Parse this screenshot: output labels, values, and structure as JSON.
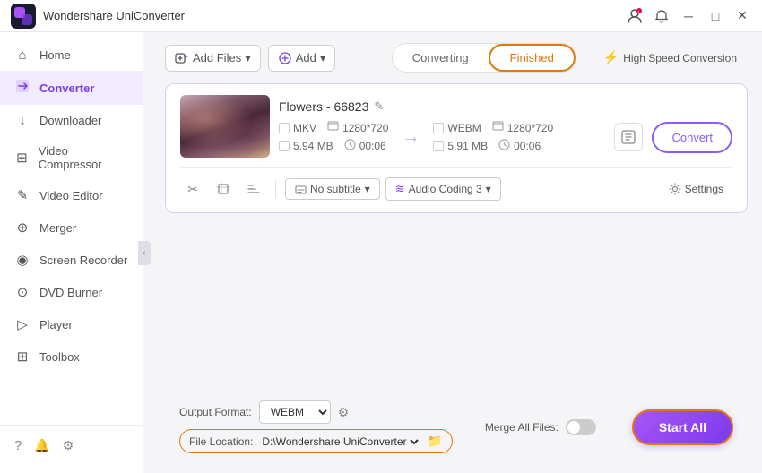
{
  "app": {
    "title": "Wondershare UniConverter",
    "logo_text": "W"
  },
  "titlebar": {
    "controls": [
      "user-icon",
      "bell-icon",
      "minimize",
      "maximize",
      "close"
    ]
  },
  "sidebar": {
    "items": [
      {
        "id": "home",
        "label": "Home",
        "icon": "⌂",
        "active": false
      },
      {
        "id": "converter",
        "label": "Converter",
        "icon": "⇄",
        "active": true
      },
      {
        "id": "downloader",
        "label": "Downloader",
        "icon": "↓",
        "active": false
      },
      {
        "id": "video-compressor",
        "label": "Video Compressor",
        "icon": "⊞",
        "active": false
      },
      {
        "id": "video-editor",
        "label": "Video Editor",
        "icon": "✂",
        "active": false
      },
      {
        "id": "merger",
        "label": "Merger",
        "icon": "⊕",
        "active": false
      },
      {
        "id": "screen-recorder",
        "label": "Screen Recorder",
        "icon": "◉",
        "active": false
      },
      {
        "id": "dvd-burner",
        "label": "DVD Burner",
        "icon": "⊙",
        "active": false
      },
      {
        "id": "player",
        "label": "Player",
        "icon": "▷",
        "active": false
      },
      {
        "id": "toolbox",
        "label": "Toolbox",
        "icon": "⊞",
        "active": false
      }
    ],
    "footer": [
      {
        "id": "help",
        "icon": "?"
      },
      {
        "id": "notifications",
        "icon": "🔔"
      },
      {
        "id": "settings",
        "icon": "⚙"
      }
    ]
  },
  "toolbar": {
    "add_file_label": "Add Files",
    "add_label": "Add",
    "tab_converting": "Converting",
    "tab_finished": "Finished",
    "high_speed_label": "High Speed Conversion"
  },
  "file_card": {
    "name": "Flowers - 66823",
    "source": {
      "format": "MKV",
      "resolution": "1280*720",
      "size": "5.94 MB",
      "duration": "00:06"
    },
    "target": {
      "format": "WEBM",
      "resolution": "1280*720",
      "size": "5.91 MB",
      "duration": "00:06"
    },
    "convert_btn": "Convert",
    "subtitle_label": "No subtitle",
    "audio_label": "Audio Coding 3",
    "settings_label": "Settings"
  },
  "bottom": {
    "output_format_label": "Output Format:",
    "output_format_value": "WEBM",
    "merge_label": "Merge All Files:",
    "file_location_label": "File Location:",
    "file_location_value": "D:\\Wondershare UniConverter",
    "start_all_label": "Start All"
  }
}
